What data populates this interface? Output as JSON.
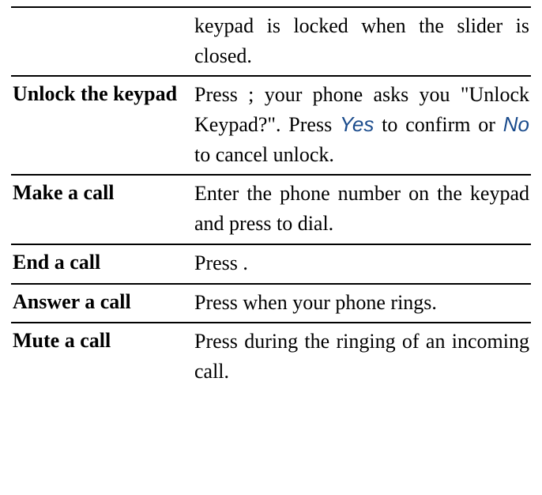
{
  "rows": [
    {
      "label": "",
      "desc": "keypad is locked when the slider is closed."
    },
    {
      "label": "Unlock the keypad",
      "desc_pre": "Press  ; your phone asks you \"Unlock Keypad?\". Press  ",
      "yes": "Yes",
      "desc_mid": " to confirm or ",
      "no": "No",
      "desc_post": " to cancel unlock.",
      "has_yesno": true
    },
    {
      "label": "Make a call",
      "desc": "Enter the phone number on the keypad and press  to dial."
    },
    {
      "label": "End a call",
      "desc": "Press  ."
    },
    {
      "label": "Answer a call",
      "desc": "Press  when your phone rings."
    },
    {
      "label": "Mute a call",
      "desc": "Press  during the ringing of an incoming call."
    }
  ]
}
